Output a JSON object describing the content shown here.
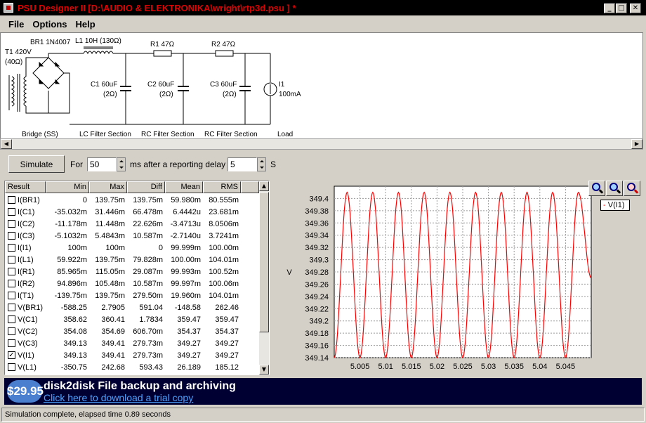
{
  "window": {
    "title": "PSU Designer II  [D:\\AUDIO & ELEKTRONIKA\\wright\\rtp3d.psu  ] *",
    "minimize": "_",
    "maximize": "□",
    "close": "✕"
  },
  "menu": [
    "File",
    "Options",
    "Help"
  ],
  "schematic": {
    "t1": "T1 420V",
    "t1_res": "(40Ω)",
    "br1": "BR1 1N4007",
    "l1": "L1 10H (130Ω)",
    "r1": "R1 47Ω",
    "r2": "R2 47Ω",
    "c1": "C1 60uF",
    "c1_res": "(2Ω)",
    "c2": "C2 60uF",
    "c2_res": "(2Ω)",
    "c3": "C3 60uF",
    "c3_res": "(2Ω)",
    "i1": "I1",
    "i1_val": "100mA",
    "sec_bridge": "Bridge (SS)",
    "sec_lc": "LC Filter Section",
    "sec_rc1": "RC Filter Section",
    "sec_rc2": "RC Filter Section",
    "sec_load": "Load"
  },
  "controls": {
    "simulate": "Simulate",
    "for": "For",
    "duration": "50",
    "ms_label": "ms  after a reporting delay of",
    "delay": "5",
    "s_label": "S"
  },
  "table": {
    "headers": [
      "Result",
      "Min",
      "Max",
      "Diff",
      "Mean",
      "RMS"
    ],
    "rows": [
      {
        "name": "I(BR1)",
        "checked": false,
        "min": "0",
        "max": "139.75m",
        "diff": "139.75m",
        "mean": "59.980m",
        "rms": "80.555m"
      },
      {
        "name": "I(C1)",
        "checked": false,
        "min": "-35.032m",
        "max": "31.446m",
        "diff": "66.478m",
        "mean": "6.4442u",
        "rms": "23.681m"
      },
      {
        "name": "I(C2)",
        "checked": false,
        "min": "-11.178m",
        "max": "11.448m",
        "diff": "22.626m",
        "mean": "-3.4713u",
        "rms": "8.0506m"
      },
      {
        "name": "I(C3)",
        "checked": false,
        "min": "-5.1032m",
        "max": "5.4843m",
        "diff": "10.587m",
        "mean": "-2.7140u",
        "rms": "3.7241m"
      },
      {
        "name": "I(I1)",
        "checked": false,
        "min": "100m",
        "max": "100m",
        "diff": "0",
        "mean": "99.999m",
        "rms": "100.00m"
      },
      {
        "name": "I(L1)",
        "checked": false,
        "min": "59.922m",
        "max": "139.75m",
        "diff": "79.828m",
        "mean": "100.00m",
        "rms": "104.01m"
      },
      {
        "name": "I(R1)",
        "checked": false,
        "min": "85.965m",
        "max": "115.05m",
        "diff": "29.087m",
        "mean": "99.993m",
        "rms": "100.52m"
      },
      {
        "name": "I(R2)",
        "checked": false,
        "min": "94.896m",
        "max": "105.48m",
        "diff": "10.587m",
        "mean": "99.997m",
        "rms": "100.06m"
      },
      {
        "name": "I(T1)",
        "checked": false,
        "min": "-139.75m",
        "max": "139.75m",
        "diff": "279.50m",
        "mean": "19.960m",
        "rms": "104.01m"
      },
      {
        "name": "V(BR1)",
        "checked": false,
        "min": "-588.25",
        "max": "2.7905",
        "diff": "591.04",
        "mean": "-148.58",
        "rms": "262.46"
      },
      {
        "name": "V(C1)",
        "checked": false,
        "min": "358.62",
        "max": "360.41",
        "diff": "1.7834",
        "mean": "359.47",
        "rms": "359.47"
      },
      {
        "name": "V(C2)",
        "checked": false,
        "min": "354.08",
        "max": "354.69",
        "diff": "606.70m",
        "mean": "354.37",
        "rms": "354.37"
      },
      {
        "name": "V(C3)",
        "checked": false,
        "min": "349.13",
        "max": "349.41",
        "diff": "279.73m",
        "mean": "349.27",
        "rms": "349.27"
      },
      {
        "name": "V(I1)",
        "checked": true,
        "min": "349.13",
        "max": "349.41",
        "diff": "279.73m",
        "mean": "349.27",
        "rms": "349.27"
      },
      {
        "name": "V(L1)",
        "checked": false,
        "min": "-350.75",
        "max": "242.68",
        "diff": "593.43",
        "mean": "26.189",
        "rms": "185.12"
      }
    ]
  },
  "chart_data": {
    "type": "line",
    "ylabel": "V",
    "xlim": [
      5.0,
      5.05
    ],
    "ylim": [
      349.14,
      349.42
    ],
    "yticks": [
      "349.4",
      "349.38",
      "349.36",
      "349.34",
      "349.32",
      "349.3",
      "349.28",
      "349.26",
      "349.24",
      "349.22",
      "349.2",
      "349.18",
      "349.16",
      "349.14"
    ],
    "xticks": [
      "5.005",
      "5.01",
      "5.015",
      "5.02",
      "5.025",
      "5.03",
      "5.035",
      "5.04",
      "5.045"
    ],
    "series": [
      {
        "name": "V(I1)",
        "color": "#ff0000",
        "x": [
          5.0,
          5.0025,
          5.005,
          5.0075,
          5.01,
          5.0125,
          5.015,
          5.0175,
          5.02,
          5.0225,
          5.025,
          5.0275,
          5.03,
          5.0325,
          5.035,
          5.0375,
          5.04,
          5.0425,
          5.045,
          5.0475,
          5.05
        ],
        "y": [
          349.14,
          349.41,
          349.14,
          349.41,
          349.14,
          349.41,
          349.14,
          349.41,
          349.14,
          349.41,
          349.14,
          349.41,
          349.14,
          349.41,
          349.14,
          349.41,
          349.14,
          349.41,
          349.14,
          349.41,
          349.27
        ]
      }
    ],
    "grid": true,
    "legend": "top-right"
  },
  "banner": {
    "price": "$29.95",
    "title": "disk2disk File backup and archiving",
    "link": "Click here to download a trial copy"
  },
  "status": "Simulation complete, elapsed time 0.89 seconds",
  "colors": {
    "title_text": "#e00000",
    "trace": "#ff0000",
    "banner_bg": "#000033"
  }
}
